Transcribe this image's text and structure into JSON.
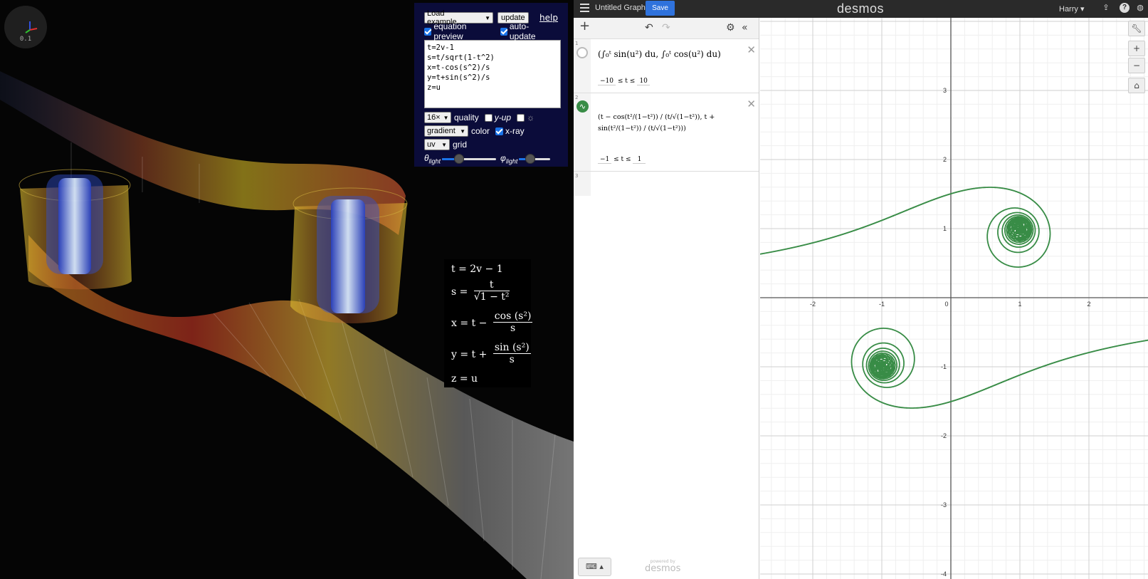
{
  "viewer": {
    "zoom_readout": "0.1",
    "controls": {
      "load_example": "Load example...",
      "update_button": "update",
      "help_link": "help",
      "equation_preview_label": "equation preview",
      "equation_preview_checked": true,
      "auto_update_label": "auto-update",
      "auto_update_checked": true,
      "equations_text": "t=2v-1\ns=t/sqrt(1-t^2)\nx=t-cos(s^2)/s\ny=t+sin(s^2)/s\nz=u",
      "quality_value": "16×",
      "quality_label": "quality",
      "y_up_label": "y-up",
      "y_up_checked": false,
      "light_toggle_label": "☼",
      "light_toggle_checked": false,
      "color_value": "gradient",
      "color_label": "color",
      "xray_label": "x-ray",
      "xray_checked": true,
      "grid_value": "uv",
      "grid_label": "grid",
      "theta_light_label": "θ",
      "theta_light_sub": "light",
      "phi_light_label": "φ",
      "phi_light_sub": "light",
      "theta_light_level": 0.28,
      "phi_light_level": 0.3
    },
    "latex_preview": {
      "line1": "t = 2v − 1",
      "line2_lhs": "s =",
      "line2_num": "t",
      "line2_den": "√1 − t²",
      "line3_lhs": "x = t −",
      "line3_num": "cos (s²)",
      "line3_den": "s",
      "line4_lhs": "y = t +",
      "line4_num": "sin (s²)",
      "line4_den": "s",
      "line5": "z = u"
    }
  },
  "desmos": {
    "graph_title": "Untitled Graph",
    "save_label": "Save",
    "brand": "desmos",
    "user_name": "Harry",
    "expressions": [
      {
        "index": "1",
        "latex": "(∫₀ᵗ sin(u²) du, ∫₀ᵗ cos(u²) du)",
        "t_min": "−10",
        "t_max": "10",
        "bound_var": "≤ t ≤",
        "enabled": false
      },
      {
        "index": "2",
        "latex": "(t − cos(t²/(1−t²)) / (t/√(1−t²)), t + sin(t²/(1−t²)) / (t/√(1−t²)))",
        "t_min": "−1",
        "t_max": "1",
        "bound_var": "≤ t ≤",
        "enabled": true,
        "color": "#388c46"
      },
      {
        "index": "3",
        "latex": ""
      }
    ],
    "powered_by": "powered by",
    "powered_brand": "desmos",
    "axis": {
      "x_ticks": [
        "-2",
        "-1",
        "0",
        "1",
        "2"
      ],
      "y_ticks": [
        "3",
        "2",
        "1",
        "-1",
        "-2",
        "-3",
        "-4"
      ]
    },
    "curve_color": "#388c46"
  }
}
